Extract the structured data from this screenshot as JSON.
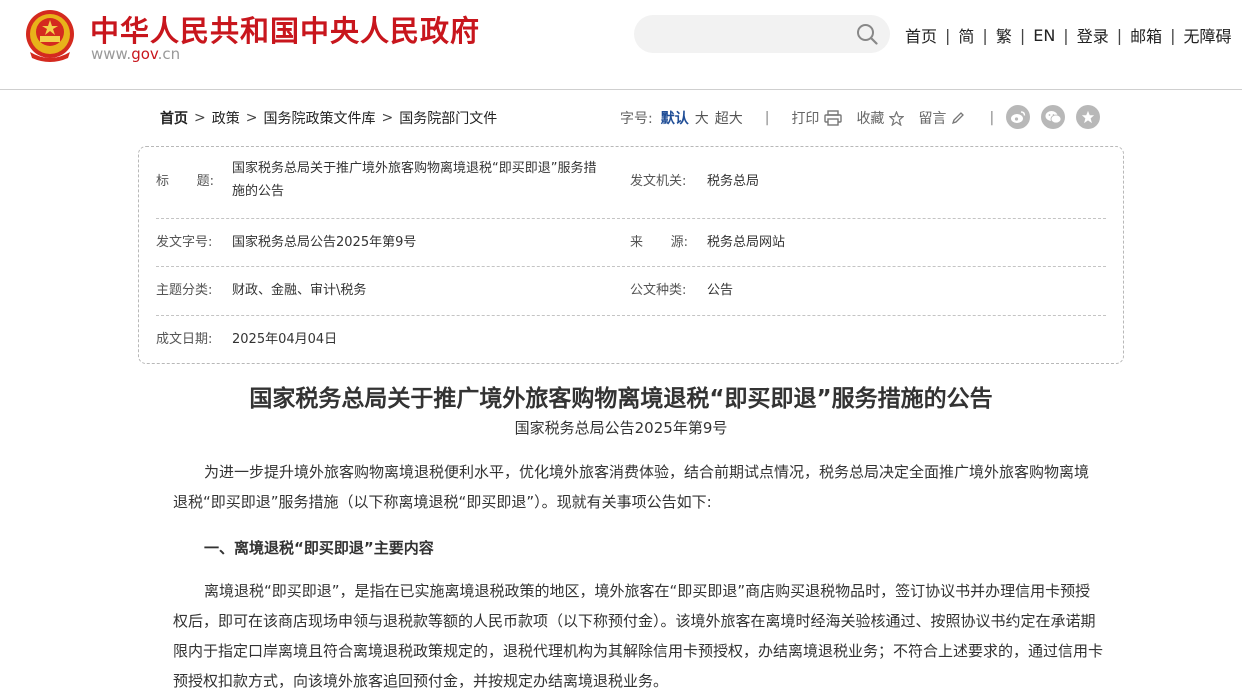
{
  "site": {
    "title": "中华人民共和国中央人民政府",
    "domain_prefix": "www.",
    "domain_gov": "gov",
    "domain_suffix": ".cn",
    "brand_color": "#c8161d"
  },
  "search": {
    "placeholder": "",
    "icon": "search-icon"
  },
  "topnav": [
    "首页",
    "简",
    "繁",
    "EN",
    "登录",
    "邮箱",
    "无障碍"
  ],
  "breadcrumb": [
    "首页",
    "政策",
    "国务院政策文件库",
    "国务院部门文件"
  ],
  "tools": {
    "font_label": "字号:",
    "font_default": "默认",
    "font_large": "大",
    "font_xlarge": "超大",
    "print": "打印",
    "favorite": "收藏",
    "comment": "留言"
  },
  "social": [
    "weibo-icon",
    "wechat-icon",
    "star-icon"
  ],
  "meta": {
    "title_label_1": "标",
    "title_label_2": "题:",
    "title_value_1": "国家税务总局关于推广境外旅客购物离境退税“即买即退”服务措",
    "title_value_2": "施的公告",
    "issuer_label": "发文机关:",
    "issuer_value": "税务总局",
    "docno_label": "发文字号:",
    "docno_value": "国家税务总局公告2025年第9号",
    "source_label_1": "来",
    "source_label_2": "源:",
    "source_value": "税务总局网站",
    "topic_label": "主题分类:",
    "topic_value": "财政、金融、审计\\税务",
    "type_label": "公文种类:",
    "type_value": "公告",
    "date_label": "成文日期:",
    "date_value": "2025年04月04日"
  },
  "article": {
    "title": "国家税务总局关于推广境外旅客购物离境退税“即买即退”服务措施的公告",
    "subtitle": "国家税务总局公告2025年第9号",
    "para1": "为进一步提升境外旅客购物离境退税便利水平，优化境外旅客消费体验，结合前期试点情况，税务总局决定全面推广境外旅客购物离境退税“即买即退”服务措施（以下称离境退税“即买即退”）。现就有关事项公告如下:",
    "heading1": "一、离境退税“即买即退”主要内容",
    "para2": "离境退税“即买即退”，是指在已实施离境退税政策的地区，境外旅客在“即买即退”商店购买退税物品时，签订协议书并办理信用卡预授权后，即可在该商店现场申领与退税款等额的人民币款项（以下称预付金）。该境外旅客在离境时经海关验核通过、按照协议书约定在承诺期限内于指定口岸离境且符合离境退税政策规定的，退税代理机构为其解除信用卡预授权，办结离境退税业务；不符合上述要求的，通过信用卡预授权扣款方式，向该境外旅客追回预付金，并按规定办结离境退税业务。"
  }
}
